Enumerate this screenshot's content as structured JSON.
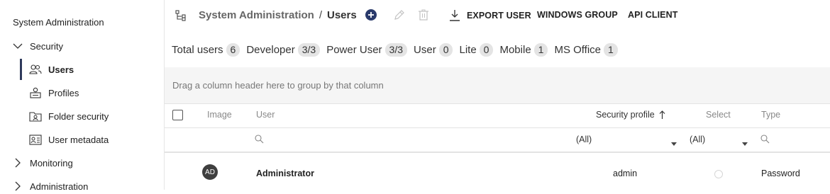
{
  "sidebar": {
    "root_title": "System Administration",
    "groups": [
      {
        "label": "Security",
        "expanded": true
      },
      {
        "label": "Monitoring",
        "expanded": false
      },
      {
        "label": "Administration",
        "expanded": false
      }
    ],
    "items": [
      {
        "label": "Users",
        "icon": "users-icon",
        "active": true
      },
      {
        "label": "Profiles",
        "icon": "profiles-icon",
        "active": false
      },
      {
        "label": "Folder security",
        "icon": "folder-security-icon",
        "active": false
      },
      {
        "label": "User metadata",
        "icon": "user-metadata-icon",
        "active": false
      }
    ]
  },
  "header": {
    "breadcrumb_parent": "System Administration",
    "breadcrumb_separator": "/",
    "breadcrumb_current": "Users",
    "actions": {
      "export_user": "EXPORT USER",
      "windows_group": "WINDOWS GROUP",
      "api_client": "API CLIENT"
    },
    "colors": {
      "add_button": "#2a3a6b",
      "disabled_icon": "#bdbdbd"
    }
  },
  "counts": [
    {
      "label": "Total users",
      "value": "6"
    },
    {
      "label": "Developer",
      "value": "3/3"
    },
    {
      "label": "Power User",
      "value": "3/3"
    },
    {
      "label": "User",
      "value": "0"
    },
    {
      "label": "Lite",
      "value": "0"
    },
    {
      "label": "Mobile",
      "value": "1"
    },
    {
      "label": "MS Office",
      "value": "1"
    }
  ],
  "grid": {
    "group_hint": "Drag a column header here to group by that column",
    "columns": {
      "image": "Image",
      "user": "User",
      "security_profile": "Security profile",
      "select": "Select",
      "type": "Type"
    },
    "sort": {
      "column": "Security profile",
      "direction": "ascending"
    },
    "filters": {
      "security_profile": "(All)",
      "select": "(All)"
    },
    "rows": [
      {
        "avatar": "AD",
        "user": "Administrator",
        "security_profile": "admin",
        "type": "Password"
      }
    ]
  }
}
